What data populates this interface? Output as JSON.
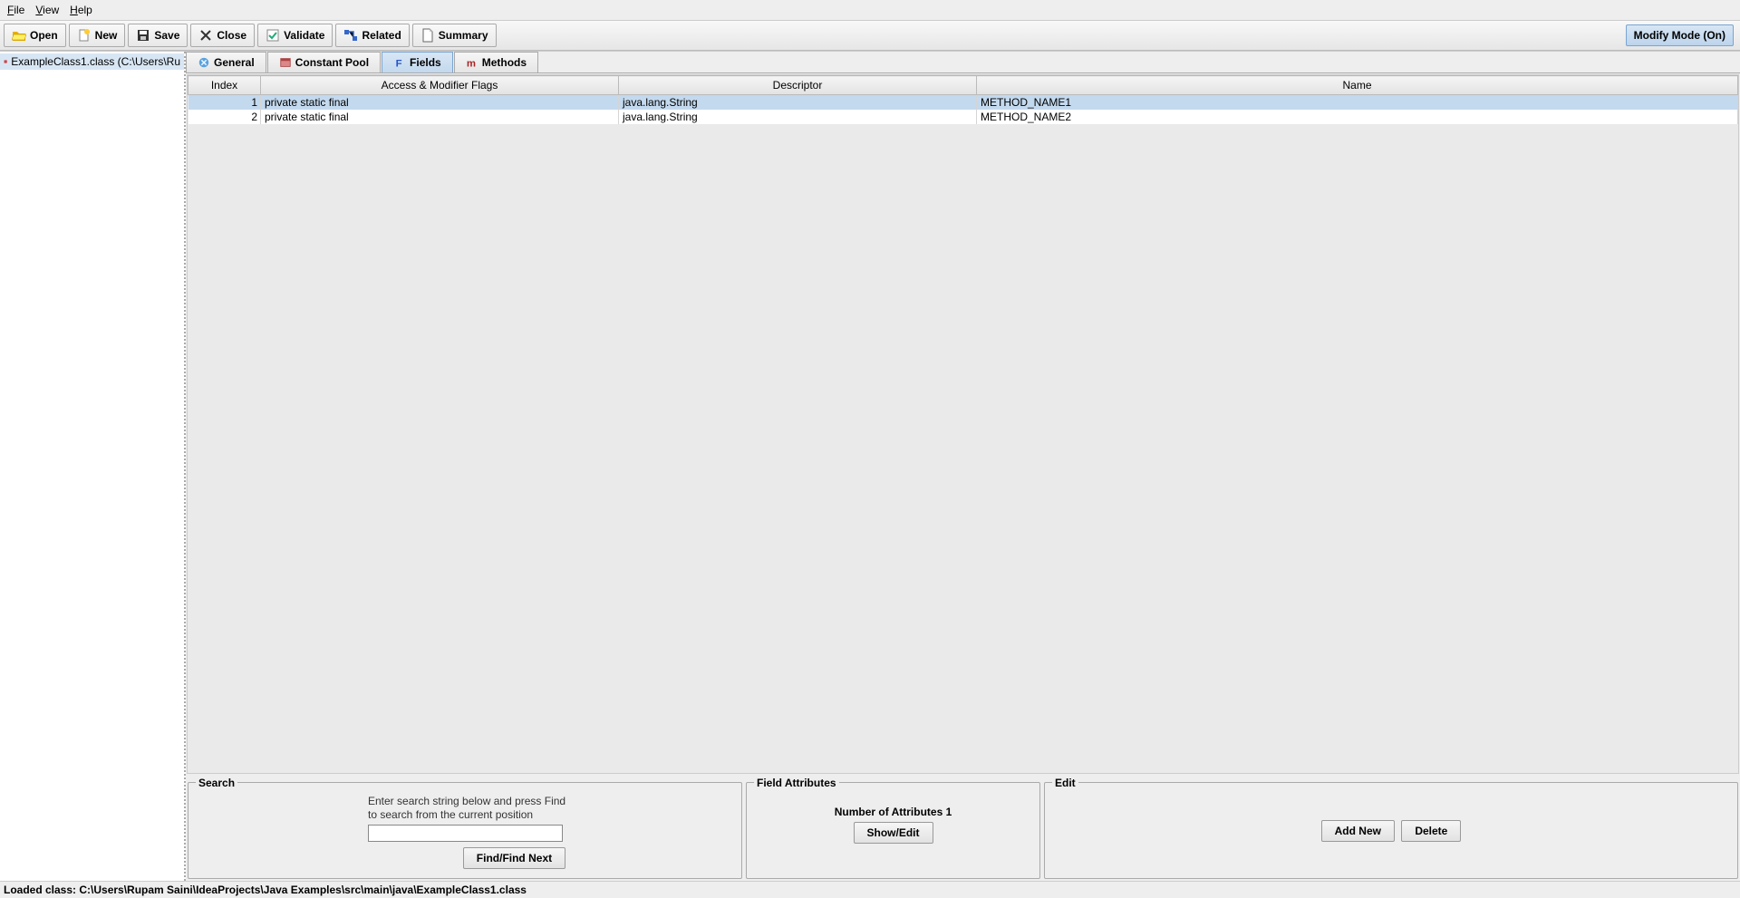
{
  "menu": {
    "file": "File",
    "view": "View",
    "help": "Help"
  },
  "toolbar": {
    "open": "Open",
    "new": "New",
    "save": "Save",
    "close": "Close",
    "validate": "Validate",
    "related": "Related",
    "summary": "Summary",
    "modify": "Modify Mode (On)"
  },
  "tree": {
    "item": "ExampleClass1.class (C:\\Users\\Ru"
  },
  "tabs": {
    "general": "General",
    "constpool": "Constant Pool",
    "fields": "Fields",
    "methods": "Methods"
  },
  "table": {
    "headers": {
      "index": "Index",
      "flags": "Access & Modifier Flags",
      "desc": "Descriptor",
      "name": "Name"
    },
    "rows": [
      {
        "index": "1",
        "flags": "private static final",
        "desc": "java.lang.String",
        "name": "METHOD_NAME1"
      },
      {
        "index": "2",
        "flags": "private static final",
        "desc": "java.lang.String",
        "name": "METHOD_NAME2"
      }
    ]
  },
  "search": {
    "title": "Search",
    "help1": "Enter search string below and press Find",
    "help2": "to search from the current position",
    "find": "Find/Find Next"
  },
  "attrs": {
    "title": "Field Attributes",
    "label": "Number of Attributes 1",
    "showedit": "Show/Edit"
  },
  "edit": {
    "title": "Edit",
    "addnew": "Add New",
    "delete": "Delete"
  },
  "status": "Loaded class: C:\\Users\\Rupam Saini\\IdeaProjects\\Java Examples\\src\\main\\java\\ExampleClass1.class"
}
